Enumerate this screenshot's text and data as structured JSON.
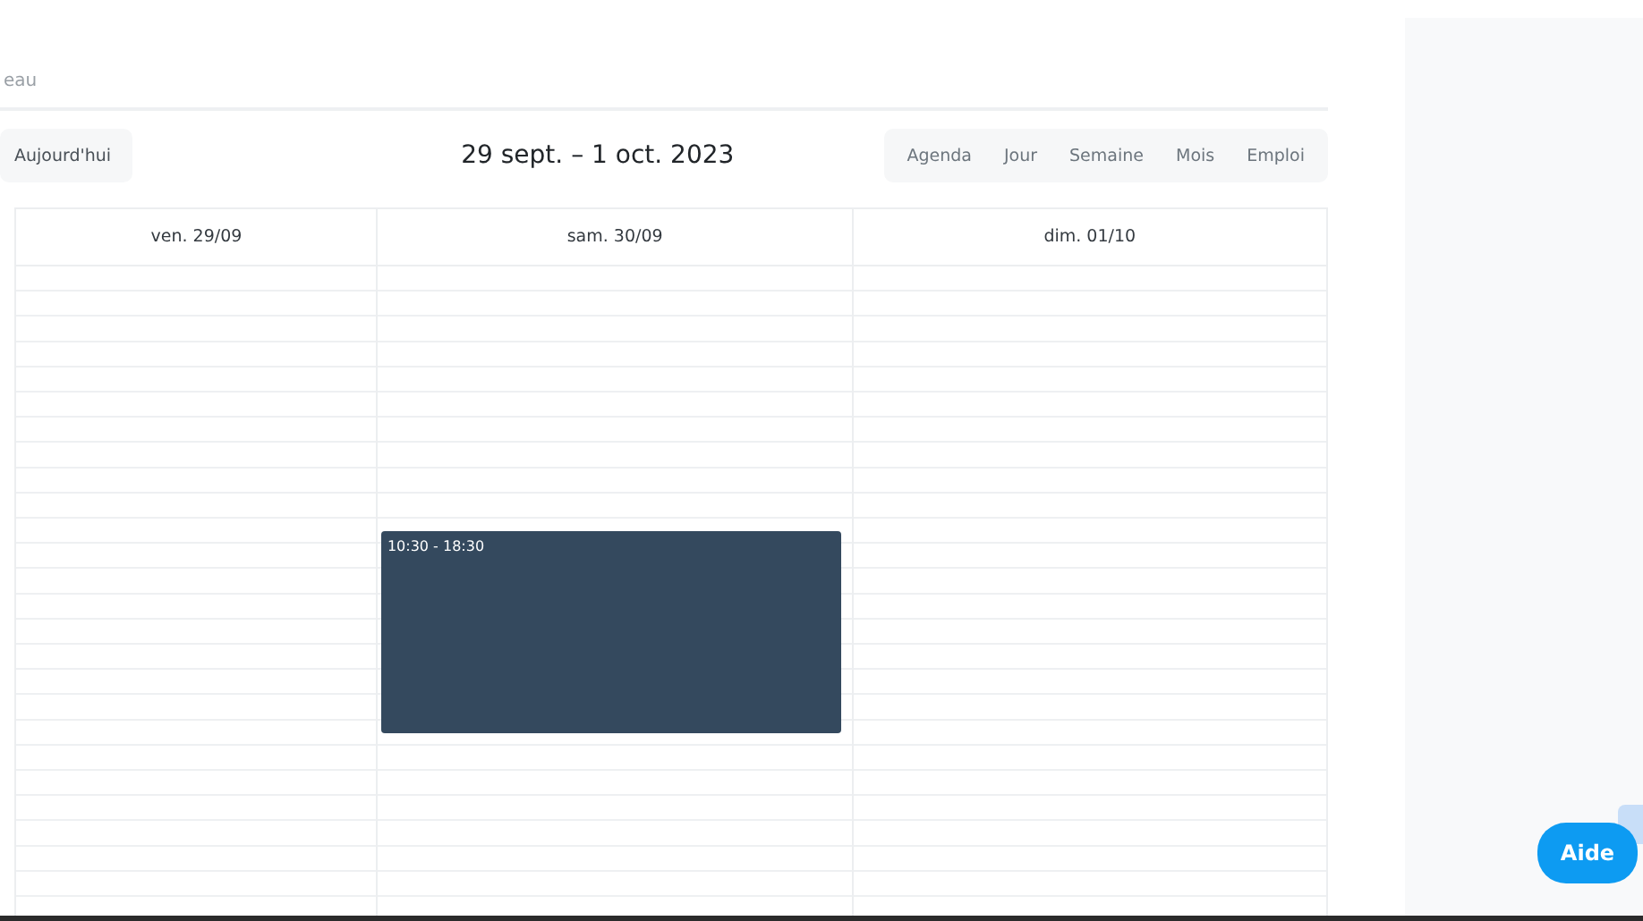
{
  "breadcrumb": "eau",
  "toolbar": {
    "today_button": "Aujourd'hui",
    "range_title": "29 sept. – 1 oct. 2023"
  },
  "views": [
    {
      "label": "Agenda",
      "selected": false
    },
    {
      "label": "Jour",
      "selected": false
    },
    {
      "label": "Semaine",
      "selected": false
    },
    {
      "label": "Mois",
      "selected": false
    },
    {
      "label": "Emploi",
      "selected": false
    }
  ],
  "days": [
    {
      "label": "ven. 29/09"
    },
    {
      "label": "sam. 30/09",
      "events": [
        {
          "time": "10:30 - 18:30"
        }
      ]
    },
    {
      "label": "dim. 01/10"
    }
  ],
  "help_button": "Aide"
}
